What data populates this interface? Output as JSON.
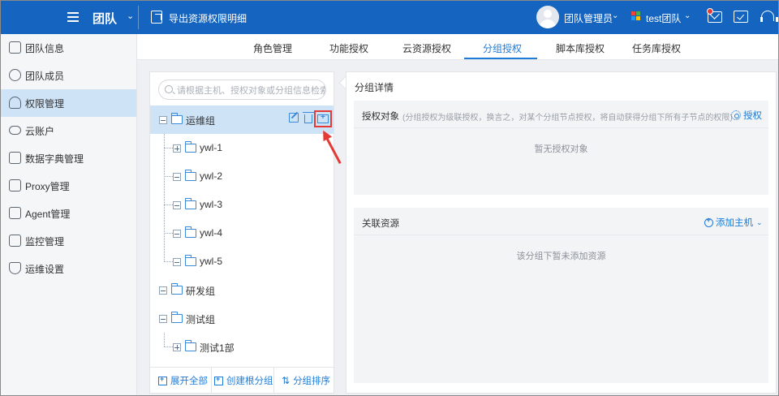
{
  "header": {
    "team_title": "团队",
    "export_label": "导出资源权限明细",
    "admin_label": "团队管理员",
    "team_selector": "test团队"
  },
  "sidebar": {
    "items": [
      {
        "label": "团队信息",
        "icon": "document-icon"
      },
      {
        "label": "团队成员",
        "icon": "users-icon"
      },
      {
        "label": "权限管理",
        "icon": "user-key-icon",
        "active": true
      },
      {
        "label": "云账户",
        "icon": "cloud-icon"
      },
      {
        "label": "数据字典管理",
        "icon": "book-icon"
      },
      {
        "label": "Proxy管理",
        "icon": "network-icon"
      },
      {
        "label": "Agent管理",
        "icon": "agent-icon"
      },
      {
        "label": "监控管理",
        "icon": "monitor-icon"
      },
      {
        "label": "运维设置",
        "icon": "shield-gear-icon"
      }
    ]
  },
  "tabs": [
    {
      "label": "角色管理"
    },
    {
      "label": "功能授权"
    },
    {
      "label": "云资源授权"
    },
    {
      "label": "分组授权",
      "active": true
    },
    {
      "label": "脚本库授权"
    },
    {
      "label": "任务库授权"
    }
  ],
  "tree": {
    "search_placeholder": "请根据主机、授权对象或分组信息检索",
    "nodes": [
      {
        "label": "运维组",
        "level": 0,
        "toggle": "minus",
        "selected": true
      },
      {
        "label": "ywl-1",
        "level": 1,
        "toggle": "plus"
      },
      {
        "label": "ywl-2",
        "level": 1,
        "toggle": "minus"
      },
      {
        "label": "ywl-3",
        "level": 1,
        "toggle": "minus"
      },
      {
        "label": "ywl-4",
        "level": 1,
        "toggle": "minus"
      },
      {
        "label": "ywl-5",
        "level": 1,
        "toggle": "minus"
      },
      {
        "label": "研发组",
        "level": 0,
        "toggle": "minus"
      },
      {
        "label": "测试组",
        "level": 0,
        "toggle": "minus"
      },
      {
        "label": "测试1部",
        "level": 1,
        "toggle": "plus"
      }
    ],
    "footer": {
      "expand_all": "展开全部",
      "create_root": "创建根分组",
      "sort": "分组排序"
    }
  },
  "detail": {
    "title": "分组详情",
    "auth": {
      "title": "授权对象",
      "note": "(分组授权为级联授权，换言之，对某个分组节点授权，将自动获得分组下所有子节点的权限)",
      "action": "授权",
      "empty": "暂无授权对象"
    },
    "resources": {
      "title": "关联资源",
      "action": "添加主机",
      "empty": "该分组下暂未添加资源"
    }
  },
  "colors": {
    "topbar": "#1565c0",
    "accent": "#1e7bd6",
    "selected_bg": "#cfe3f7",
    "highlight": "#e53935"
  }
}
